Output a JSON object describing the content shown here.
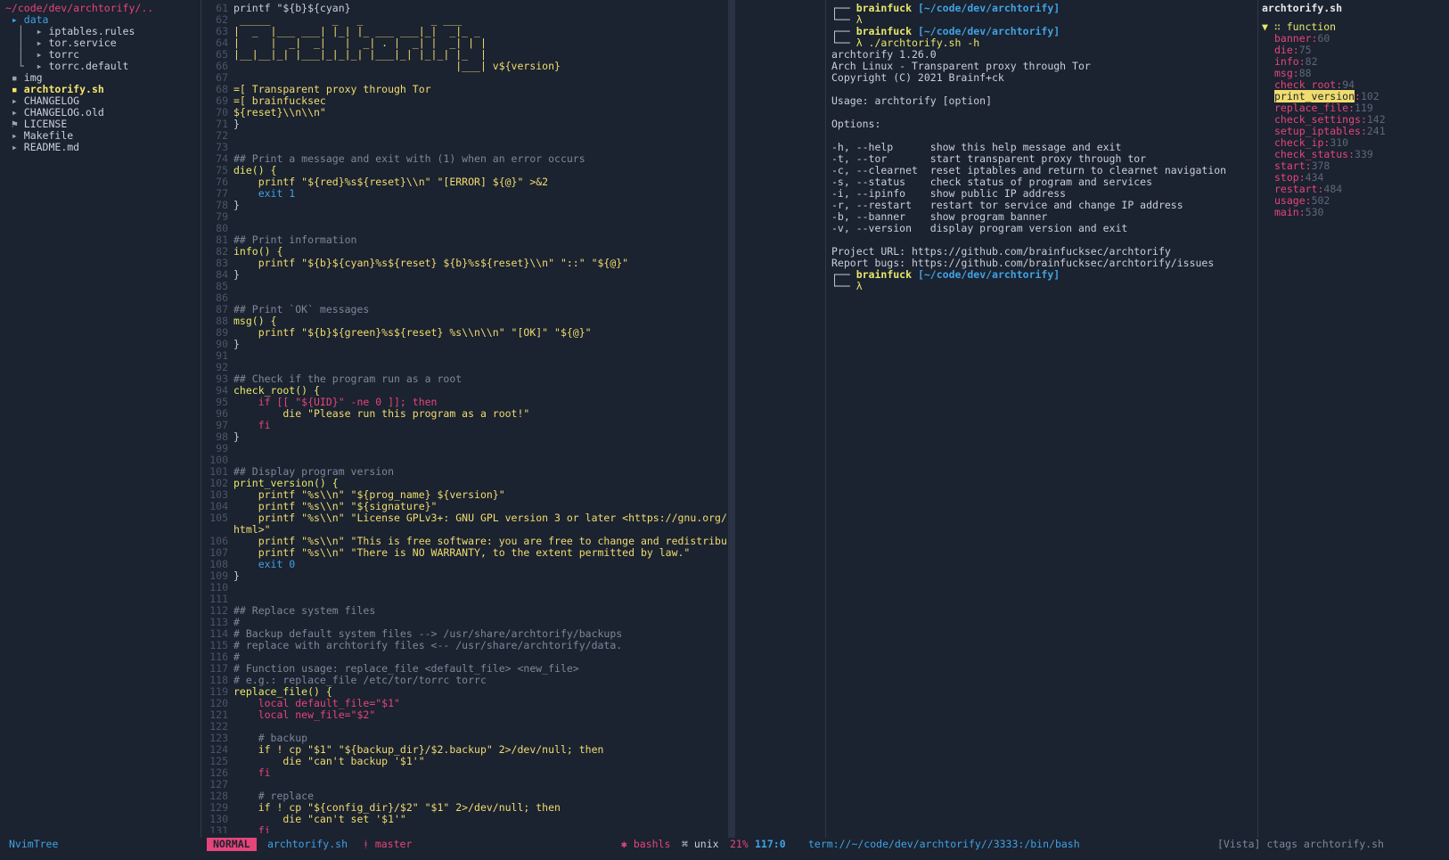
{
  "tree": {
    "root": "~/code/dev/archtorify/..",
    "items": [
      {
        "prefix": " ▸ ",
        "label": "data",
        "kind": "dir"
      },
      {
        "prefix": "  │  ▸ ",
        "label": "iptables.rules",
        "kind": "file"
      },
      {
        "prefix": "  │  ▸ ",
        "label": "tor.service",
        "kind": "file"
      },
      {
        "prefix": "  │  ▸ ",
        "label": "torrc",
        "kind": "file"
      },
      {
        "prefix": "  └  ▸ ",
        "label": "torrc.default",
        "kind": "file"
      },
      {
        "prefix": " ▪ ",
        "label": "img",
        "kind": "file"
      },
      {
        "prefix": " ▪ ",
        "label": "archtorify.sh",
        "kind": "selected"
      },
      {
        "prefix": " ▸ ",
        "label": "CHANGELOG",
        "kind": "file"
      },
      {
        "prefix": " ▸ ",
        "label": "CHANGELOG.old",
        "kind": "file"
      },
      {
        "prefix": " ⚑ ",
        "label": "LICENSE",
        "kind": "file"
      },
      {
        "prefix": " ▸ ",
        "label": "Makefile",
        "kind": "file"
      },
      {
        "prefix": " ▸ ",
        "label": "README.md",
        "kind": "file"
      }
    ]
  },
  "editor": {
    "lines": [
      {
        "n": "61",
        "t": "printf \"${b}${cyan}",
        "c": "w"
      },
      {
        "n": "62",
        "t": " _____          _   _           _ ___",
        "c": "y"
      },
      {
        "n": "63",
        "t": "|  _  |___ ___| |_| |_ ___ ___|_|  _|_ _",
        "c": "y"
      },
      {
        "n": "64",
        "t": "|     |  _|  _|   |  _| . |  _| |  _| | |",
        "c": "y"
      },
      {
        "n": "65",
        "t": "|__|__|_| |___|_|_|_| |___|_| |_|_| |_  |",
        "c": "y"
      },
      {
        "n": "66",
        "t": "                                    |___| v${version}",
        "c": "y"
      },
      {
        "n": "67",
        "t": "",
        "c": "w"
      },
      {
        "n": "68",
        "t": "=[ Transparent proxy through Tor",
        "c": "y"
      },
      {
        "n": "69",
        "t": "=[ brainfucksec",
        "c": "y"
      },
      {
        "n": "70",
        "t": "${reset}\\\\n\\\\n\"",
        "c": "y"
      },
      {
        "n": "71",
        "t": "}",
        "c": "w"
      },
      {
        "n": "72",
        "t": "",
        "c": "w"
      },
      {
        "n": "73",
        "t": "",
        "c": "w"
      },
      {
        "n": "74",
        "t": "## Print a message and exit with (1) when an error occurs",
        "c": "c"
      },
      {
        "n": "75",
        "t": "die() {",
        "c": "fn"
      },
      {
        "n": "76",
        "t": "    printf \"${red}%s${reset}\\\\n\" \"[ERROR] ${@}\" >&2",
        "c": "y"
      },
      {
        "n": "77",
        "t": "    exit 1",
        "c": "v"
      },
      {
        "n": "78",
        "t": "}",
        "c": "w"
      },
      {
        "n": "79",
        "t": "",
        "c": "w"
      },
      {
        "n": "80",
        "t": "",
        "c": "w"
      },
      {
        "n": "81",
        "t": "## Print information",
        "c": "c"
      },
      {
        "n": "82",
        "t": "info() {",
        "c": "fn"
      },
      {
        "n": "83",
        "t": "    printf \"${b}${cyan}%s${reset} ${b}%s${reset}\\\\n\" \"::\" \"${@}\"",
        "c": "y"
      },
      {
        "n": "84",
        "t": "}",
        "c": "w"
      },
      {
        "n": "85",
        "t": "",
        "c": "w"
      },
      {
        "n": "86",
        "t": "",
        "c": "w"
      },
      {
        "n": "87",
        "t": "## Print `OK` messages",
        "c": "c"
      },
      {
        "n": "88",
        "t": "msg() {",
        "c": "fn"
      },
      {
        "n": "89",
        "t": "    printf \"${b}${green}%s${reset} %s\\\\n\\\\n\" \"[OK]\" \"${@}\"",
        "c": "y"
      },
      {
        "n": "90",
        "t": "}",
        "c": "w"
      },
      {
        "n": "91",
        "t": "",
        "c": "w"
      },
      {
        "n": "92",
        "t": "",
        "c": "w"
      },
      {
        "n": "93",
        "t": "## Check if the program run as a root",
        "c": "c"
      },
      {
        "n": "94",
        "t": "check_root() {",
        "c": "fn"
      },
      {
        "n": "95",
        "t": "    if [[ \"${UID}\" -ne 0 ]]; then",
        "c": "k"
      },
      {
        "n": "96",
        "t": "        die \"Please run this program as a root!\"",
        "c": "y"
      },
      {
        "n": "97",
        "t": "    fi",
        "c": "k"
      },
      {
        "n": "98",
        "t": "}",
        "c": "w"
      },
      {
        "n": "99",
        "t": "",
        "c": "w"
      },
      {
        "n": "100",
        "t": "",
        "c": "w"
      },
      {
        "n": "101",
        "t": "## Display program version",
        "c": "c"
      },
      {
        "n": "102",
        "t": "print_version() {",
        "c": "fn"
      },
      {
        "n": "103",
        "t": "    printf \"%s\\\\n\" \"${prog_name} ${version}\"",
        "c": "y"
      },
      {
        "n": "104",
        "t": "    printf \"%s\\\\n\" \"${signature}\"",
        "c": "y"
      },
      {
        "n": "105",
        "t": "    printf \"%s\\\\n\" \"License GPLv3+: GNU GPL version 3 or later <https://gnu.org/licenses/gpl.",
        "c": "y"
      },
      {
        "n": "",
        "t": "html>\"",
        "c": "y"
      },
      {
        "n": "106",
        "t": "    printf \"%s\\\\n\" \"This is free software: you are free to change and redistribute it.\"",
        "c": "y"
      },
      {
        "n": "107",
        "t": "    printf \"%s\\\\n\" \"There is NO WARRANTY, to the extent permitted by law.\"",
        "c": "y"
      },
      {
        "n": "108",
        "t": "    exit 0",
        "c": "v"
      },
      {
        "n": "109",
        "t": "}",
        "c": "w"
      },
      {
        "n": "110",
        "t": "",
        "c": "w"
      },
      {
        "n": "111",
        "t": "",
        "c": "w"
      },
      {
        "n": "112",
        "t": "## Replace system files",
        "c": "c"
      },
      {
        "n": "113",
        "t": "#",
        "c": "c"
      },
      {
        "n": "114",
        "t": "# Backup default system files --> /usr/share/archtorify/backups",
        "c": "c"
      },
      {
        "n": "115",
        "t": "# replace with archtorify files <-- /usr/share/archtorify/data.",
        "c": "c"
      },
      {
        "n": "116",
        "t": "#",
        "c": "c"
      },
      {
        "n": "117",
        "t": "# Function usage: replace_file <default_file> <new_file>",
        "c": "c"
      },
      {
        "n": "118",
        "t": "# e.g.: replace_file /etc/tor/torrc torrc",
        "c": "c"
      },
      {
        "n": "119",
        "t": "replace_file() {",
        "c": "fn"
      },
      {
        "n": "120",
        "t": "    local default_file=\"$1\"",
        "c": "k"
      },
      {
        "n": "121",
        "t": "    local new_file=\"$2\"",
        "c": "k"
      },
      {
        "n": "122",
        "t": "",
        "c": "w"
      },
      {
        "n": "123",
        "t": "    # backup",
        "c": "c"
      },
      {
        "n": "124",
        "t": "    if ! cp \"$1\" \"${backup_dir}/$2.backup\" 2>/dev/null; then",
        "c": "y"
      },
      {
        "n": "125",
        "t": "        die \"can't backup '$1'\"",
        "c": "y"
      },
      {
        "n": "126",
        "t": "    fi",
        "c": "k"
      },
      {
        "n": "127",
        "t": "",
        "c": "w"
      },
      {
        "n": "128",
        "t": "    # replace",
        "c": "c"
      },
      {
        "n": "129",
        "t": "    if ! cp \"${config_dir}/$2\" \"$1\" 2>/dev/null; then",
        "c": "y"
      },
      {
        "n": "130",
        "t": "        die \"can't set '$1'\"",
        "c": "y"
      },
      {
        "n": "131",
        "t": "    fi",
        "c": "k"
      }
    ]
  },
  "terminal": {
    "user": "brainfuck",
    "path": "[~/code/dev/archtorify]",
    "lines": [
      {
        "t": "",
        "kind": "prompt"
      },
      {
        "t": "λ",
        "kind": "cmd"
      },
      {
        "t": "",
        "kind": "prompt"
      },
      {
        "t": "λ ./archtorify.sh -h",
        "kind": "cmd"
      },
      {
        "t": "archtorify 1.26.0",
        "kind": "out"
      },
      {
        "t": "Arch Linux - Transparent proxy through Tor",
        "kind": "out"
      },
      {
        "t": "Copyright (C) 2021 Brainf+ck",
        "kind": "out"
      },
      {
        "t": "",
        "kind": "out"
      },
      {
        "t": "Usage: archtorify [option]",
        "kind": "out"
      },
      {
        "t": "",
        "kind": "out"
      },
      {
        "t": "Options:",
        "kind": "out"
      },
      {
        "t": "",
        "kind": "out"
      },
      {
        "t": "-h, --help      show this help message and exit",
        "kind": "out"
      },
      {
        "t": "-t, --tor       start transparent proxy through tor",
        "kind": "out"
      },
      {
        "t": "-c, --clearnet  reset iptables and return to clearnet navigation",
        "kind": "out"
      },
      {
        "t": "-s, --status    check status of program and services",
        "kind": "out"
      },
      {
        "t": "-i, --ipinfo    show public IP address",
        "kind": "out"
      },
      {
        "t": "-r, --restart   restart tor service and change IP address",
        "kind": "out"
      },
      {
        "t": "-b, --banner    show program banner",
        "kind": "out"
      },
      {
        "t": "-v, --version   display program version and exit",
        "kind": "out"
      },
      {
        "t": "",
        "kind": "out"
      },
      {
        "t": "Project URL: https://github.com/brainfucksec/archtorify",
        "kind": "out"
      },
      {
        "t": "Report bugs: https://github.com/brainfucksec/archtorify/issues",
        "kind": "out"
      },
      {
        "t": "",
        "kind": "prompt"
      },
      {
        "t": "λ",
        "kind": "cmd"
      }
    ]
  },
  "vista": {
    "title": "archtorify.sh",
    "group": "▼ ∷ function",
    "tags": [
      {
        "name": "banner",
        "line": "60"
      },
      {
        "name": "die",
        "line": "75"
      },
      {
        "name": "info",
        "line": "82"
      },
      {
        "name": "msg",
        "line": "88"
      },
      {
        "name": "check_root",
        "line": "94"
      },
      {
        "name": "print_version",
        "line": "102",
        "active": true
      },
      {
        "name": "replace_file",
        "line": "119"
      },
      {
        "name": "check_settings",
        "line": "142"
      },
      {
        "name": "setup_iptables",
        "line": "241"
      },
      {
        "name": "check_ip",
        "line": "310"
      },
      {
        "name": "check_status",
        "line": "339"
      },
      {
        "name": "start",
        "line": "378"
      },
      {
        "name": "stop",
        "line": "434"
      },
      {
        "name": "restart",
        "line": "484"
      },
      {
        "name": "usage",
        "line": "502"
      },
      {
        "name": "main",
        "line": "530"
      }
    ]
  },
  "status": {
    "tree_label": "NvimTree",
    "mode": "NORMAL",
    "file": "archtorify.sh",
    "branch": "ᚼ master",
    "lsp": "✱ bashls",
    "format": "⌘ unix",
    "percent": "21%",
    "position": "117:0",
    "term": "term://~/code/dev/archtorify//3333:/bin/bash",
    "vista": "[Vista] ctags archtorify.sh"
  },
  "colors": {
    "bg": "#1b2230",
    "accent_pink": "#e6457a",
    "accent_yellow": "#f1dd6e",
    "accent_blue": "#3fa3e2"
  }
}
